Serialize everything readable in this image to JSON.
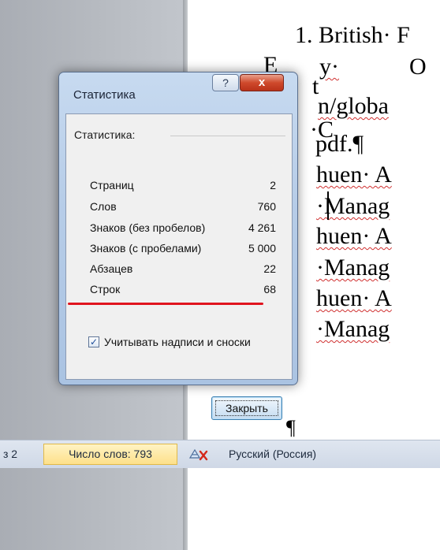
{
  "document": {
    "lines": [
      "1. British· F",
      "E",
      "y·",
      "O",
      "t",
      "n/globa",
      "·C",
      "pdf.¶",
      "huen· A",
      "·Manag",
      "huen· A",
      "·Manag",
      "huen· A",
      "·Manag",
      "¶"
    ]
  },
  "dialog": {
    "title": "Статистика",
    "help_label": "?",
    "close_label": "x",
    "group_label": "Статистика:",
    "rows": [
      {
        "label": "Страниц",
        "value": "2"
      },
      {
        "label": "Слов",
        "value": "760"
      },
      {
        "label": "Знаков (без пробелов)",
        "value": "4 261"
      },
      {
        "label": "Знаков (с пробелами)",
        "value": "5 000"
      },
      {
        "label": "Абзацев",
        "value": "22"
      },
      {
        "label": "Строк",
        "value": "68"
      }
    ],
    "checkbox_label": "Учитывать надписи и сноски",
    "checkbox_checked": true,
    "ok_label": "Закрыть"
  },
  "statusbar": {
    "pages": "з 2",
    "words": "Число слов: 793",
    "language": "Русский (Россия)"
  }
}
